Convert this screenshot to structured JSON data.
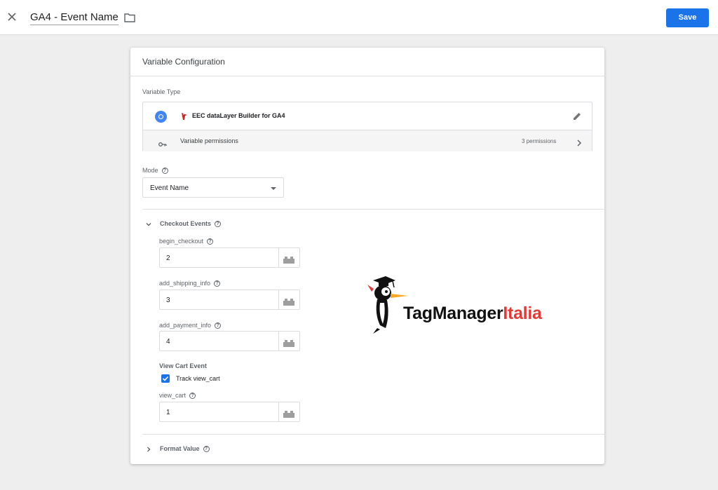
{
  "header": {
    "title": "GA4 - Event Name",
    "save_label": "Save"
  },
  "card": {
    "title": "Variable Configuration",
    "variable_type_label": "Variable Type",
    "template_name": "EEC dataLayer Builder for GA4",
    "permissions_label": "Variable permissions",
    "permissions_count": "3 permissions",
    "mode_label": "Mode",
    "mode_value": "Event Name",
    "checkout_section": "Checkout Events",
    "fields": [
      {
        "label": "begin_checkout",
        "value": "2"
      },
      {
        "label": "add_shipping_info",
        "value": "3"
      },
      {
        "label": "add_payment_info",
        "value": "4"
      }
    ],
    "view_cart_heading": "View Cart Event",
    "track_view_cart_label": "Track view_cart",
    "track_view_cart_checked": true,
    "view_cart": {
      "label": "view_cart",
      "value": "1"
    },
    "format_section": "Format Value"
  },
  "logo": {
    "part1": "TagManager",
    "part2": "Italia"
  },
  "colors": {
    "accent": "#1a73e8",
    "logo_red": "#e53935"
  }
}
